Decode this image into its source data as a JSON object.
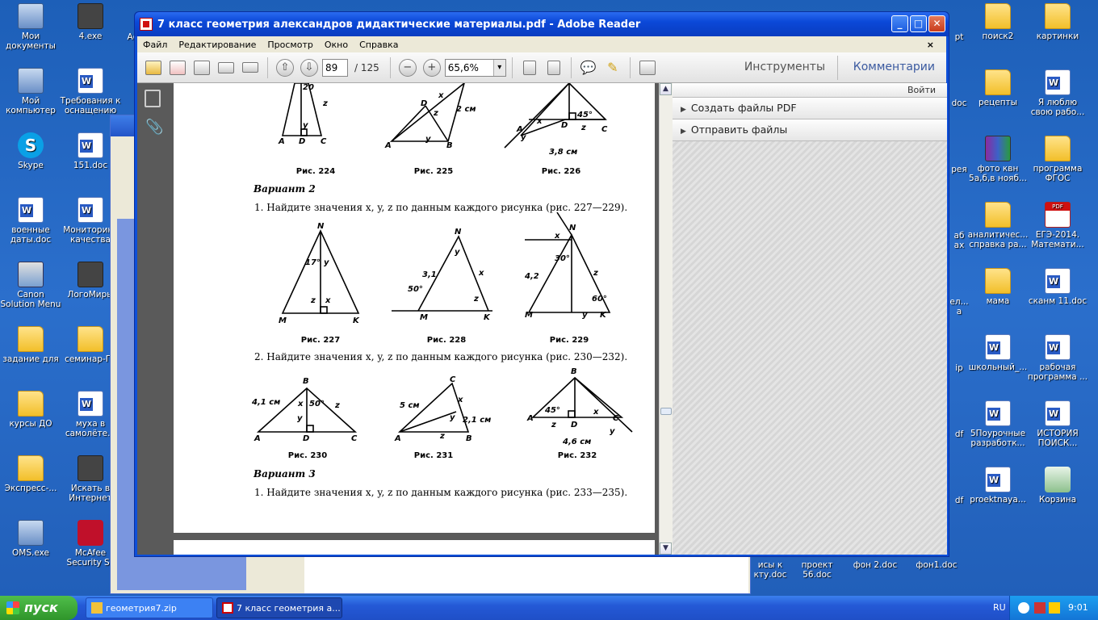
{
  "desktop": {
    "left_icons": [
      {
        "label": "Мои документы",
        "kind": "comp"
      },
      {
        "label": "Мой компьютер",
        "kind": "comp"
      },
      {
        "label": "Skype",
        "kind": "skype"
      },
      {
        "label": "военные даты.doc",
        "kind": "doc"
      },
      {
        "label": "Canon Solution Menu",
        "kind": "canon"
      },
      {
        "label": "задание для",
        "kind": "folder"
      },
      {
        "label": "курсы ДО",
        "kind": "folder"
      },
      {
        "label": "Экспресс-...",
        "kind": "folder"
      },
      {
        "label": "OMS.exe",
        "kind": "comp"
      }
    ],
    "second_col": [
      {
        "label": "4.exe",
        "kind": "exe"
      },
      {
        "label": "Требования к оснащению",
        "kind": "doc"
      },
      {
        "label": "151.doc",
        "kind": "doc"
      },
      {
        "label": "Мониторинг качества",
        "kind": "doc"
      },
      {
        "label": "ЛогоМиры",
        "kind": "exe"
      },
      {
        "label": "семинар-Гл",
        "kind": "folder"
      },
      {
        "label": "муха в самолёте.d",
        "kind": "doc"
      },
      {
        "label": "Искать в Интернет",
        "kind": "exe"
      },
      {
        "label": "McAfee Security Sc",
        "kind": "mcafee"
      }
    ],
    "right_col1": [
      {
        "label": "поиск2",
        "kind": "folder"
      },
      {
        "label": "рецепты",
        "kind": "folder"
      },
      {
        "label": "фото квн 5а,б,в нояб...",
        "kind": "rar"
      },
      {
        "label": "аналитичес... справка ра...",
        "kind": "folder"
      },
      {
        "label": "мама",
        "kind": "folder"
      },
      {
        "label": "школьный_...",
        "kind": "doc"
      },
      {
        "label": "5Поурочные разработк...",
        "kind": "doc"
      },
      {
        "label": "proektnaya...",
        "kind": "doc"
      }
    ],
    "right_col2": [
      {
        "label": "картинки",
        "kind": "folder"
      },
      {
        "label": "Я люблю свою рабо...",
        "kind": "doc"
      },
      {
        "label": "программа ФГОС",
        "kind": "folder"
      },
      {
        "label": "ЕГЭ-2014. Математи...",
        "kind": "pdf"
      },
      {
        "label": "сканм 11.doc",
        "kind": "doc"
      },
      {
        "label": "рабочая программа ...",
        "kind": "doc"
      },
      {
        "label": "ИСТОРИЯ ПОИСК...",
        "kind": "doc"
      },
      {
        "label": "Корзина",
        "kind": "trash"
      }
    ],
    "partial_labels": [
      "Ас",
      "pt",
      "doc",
      "рея",
      "аб",
      "ах",
      "ел...",
      "а",
      "ip",
      "df",
      "df"
    ],
    "bottom_labels": [
      "исы к кту.doc",
      "проект 56.doc",
      "фон 2.doc",
      "фон1.doc"
    ]
  },
  "window": {
    "title": "7 класс геометрия александров  дидактические материалы.pdf - Adobe Reader",
    "menu": [
      "Файл",
      "Редактирование",
      "Просмотр",
      "Окно",
      "Справка"
    ],
    "page_current": "89",
    "page_total": "/ 125",
    "zoom": "65,6%",
    "tools_label": "Инструменты",
    "comments_label": "Комментарии"
  },
  "panel": {
    "signin": "Войти",
    "items": [
      "Создать файлы PDF",
      "Отправить файлы"
    ]
  },
  "document": {
    "captions_row1": [
      "Рис. 224",
      "Рис. 225",
      "Рис. 226"
    ],
    "variant2": "Вариант 2",
    "task1": "1.  Найдите значения x, y, z по данным каждого рисунка (рис. 227—229).",
    "captions_row2": [
      "Рис. 227",
      "Рис. 228",
      "Рис. 229"
    ],
    "task2": "2.  Найдите значения x, y, z по данным каждого рисунка (рис. 230—232).",
    "captions_row3": [
      "Рис. 230",
      "Рис. 231",
      "Рис. 232"
    ],
    "variant3": "Вариант 3",
    "task3": "1.  Найдите значения x, y, z по данным каждого рисунка (рис. 233—235)."
  },
  "taskbar": {
    "start": "пуск",
    "btn1": "геометрия7.zip",
    "btn2": "7 класс геометрия а...",
    "lang": "RU",
    "time": "9:01"
  }
}
